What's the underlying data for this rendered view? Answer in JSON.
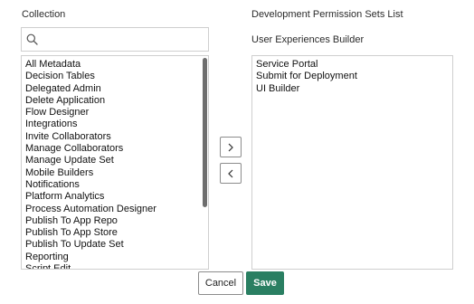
{
  "collection": {
    "title": "Collection",
    "search": {
      "value": "",
      "placeholder": "",
      "icon": "search-icon"
    },
    "items": [
      "All Metadata",
      "Decision Tables",
      "Delegated Admin",
      "Delete Application",
      "Flow Designer",
      "Integrations",
      "Invite Collaborators",
      "Manage Collaborators",
      "Manage Update Set",
      "Mobile Builders",
      "Notifications",
      "Platform Analytics",
      "Process Automation Designer",
      "Publish To App Repo",
      "Publish To App Store",
      "Publish To Update Set",
      "Reporting",
      "Script Edit"
    ]
  },
  "target": {
    "title": "Development Permission Sets List",
    "subtitle": "User Experiences Builder",
    "items": [
      "Service Portal",
      "Submit for Deployment",
      "UI Builder"
    ]
  },
  "controls": {
    "move_right_icon": "chevron-right-icon",
    "move_left_icon": "chevron-left-icon"
  },
  "actions": {
    "cancel_label": "Cancel",
    "save_label": "Save",
    "save_color": "#2a7f62"
  }
}
